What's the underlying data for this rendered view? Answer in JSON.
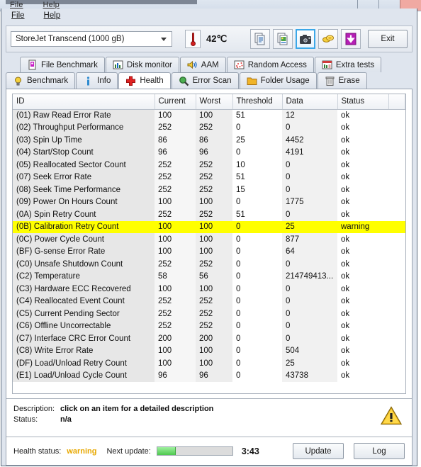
{
  "background_window": {
    "menu": [
      "File",
      "Help"
    ]
  },
  "window": {
    "menu": [
      "File",
      "Help"
    ]
  },
  "toolbar": {
    "drive": "StoreJet Transcend (1000 gB)",
    "temperature": "42℃",
    "exit_label": "Exit",
    "icons": [
      {
        "name": "copy-text-icon",
        "title": "copy text"
      },
      {
        "name": "copy-image-icon",
        "title": "copy image"
      },
      {
        "name": "screenshot-camera-icon",
        "title": "screenshot",
        "active": true
      },
      {
        "name": "coins-icon",
        "title": "donate"
      },
      {
        "name": "download-arrow-icon",
        "title": "save"
      }
    ]
  },
  "tabs": {
    "row1": [
      {
        "label": "File Benchmark",
        "icon": "file-benchmark-icon"
      },
      {
        "label": "Disk monitor",
        "icon": "disk-monitor-icon"
      },
      {
        "label": "AAM",
        "icon": "aam-speaker-icon"
      },
      {
        "label": "Random Access",
        "icon": "random-access-icon"
      },
      {
        "label": "Extra tests",
        "icon": "extra-tests-icon"
      }
    ],
    "row2": [
      {
        "label": "Benchmark",
        "icon": "benchmark-bulb-icon"
      },
      {
        "label": "Info",
        "icon": "info-icon"
      },
      {
        "label": "Health",
        "icon": "health-cross-icon",
        "active": true
      },
      {
        "label": "Error Scan",
        "icon": "error-scan-magnifier-icon"
      },
      {
        "label": "Folder Usage",
        "icon": "folder-usage-icon"
      },
      {
        "label": "Erase",
        "icon": "erase-trash-icon"
      }
    ]
  },
  "table": {
    "columns": [
      "ID",
      "Current",
      "Worst",
      "Threshold",
      "Data",
      "Status"
    ],
    "rows": [
      {
        "id": "(01) Raw Read Error Rate",
        "current": "100",
        "worst": "100",
        "threshold": "51",
        "data": "12",
        "status": "ok"
      },
      {
        "id": "(02) Throughput Performance",
        "current": "252",
        "worst": "252",
        "threshold": "0",
        "data": "0",
        "status": "ok"
      },
      {
        "id": "(03) Spin Up Time",
        "current": "86",
        "worst": "86",
        "threshold": "25",
        "data": "4452",
        "status": "ok"
      },
      {
        "id": "(04) Start/Stop Count",
        "current": "96",
        "worst": "96",
        "threshold": "0",
        "data": "4191",
        "status": "ok"
      },
      {
        "id": "(05) Reallocated Sector Count",
        "current": "252",
        "worst": "252",
        "threshold": "10",
        "data": "0",
        "status": "ok"
      },
      {
        "id": "(07) Seek Error Rate",
        "current": "252",
        "worst": "252",
        "threshold": "51",
        "data": "0",
        "status": "ok"
      },
      {
        "id": "(08) Seek Time Performance",
        "current": "252",
        "worst": "252",
        "threshold": "15",
        "data": "0",
        "status": "ok"
      },
      {
        "id": "(09) Power On Hours Count",
        "current": "100",
        "worst": "100",
        "threshold": "0",
        "data": "1775",
        "status": "ok"
      },
      {
        "id": "(0A) Spin Retry Count",
        "current": "252",
        "worst": "252",
        "threshold": "51",
        "data": "0",
        "status": "ok"
      },
      {
        "id": "(0B) Calibration Retry Count",
        "current": "100",
        "worst": "100",
        "threshold": "0",
        "data": "25",
        "status": "warning",
        "warn": true
      },
      {
        "id": "(0C) Power Cycle Count",
        "current": "100",
        "worst": "100",
        "threshold": "0",
        "data": "877",
        "status": "ok"
      },
      {
        "id": "(BF) G-sense Error Rate",
        "current": "100",
        "worst": "100",
        "threshold": "0",
        "data": "64",
        "status": "ok"
      },
      {
        "id": "(C0) Unsafe Shutdown Count",
        "current": "252",
        "worst": "252",
        "threshold": "0",
        "data": "0",
        "status": "ok"
      },
      {
        "id": "(C2) Temperature",
        "current": "58",
        "worst": "56",
        "threshold": "0",
        "data": "214749413...",
        "status": "ok"
      },
      {
        "id": "(C3) Hardware ECC Recovered",
        "current": "100",
        "worst": "100",
        "threshold": "0",
        "data": "0",
        "status": "ok"
      },
      {
        "id": "(C4) Reallocated Event Count",
        "current": "252",
        "worst": "252",
        "threshold": "0",
        "data": "0",
        "status": "ok"
      },
      {
        "id": "(C5) Current Pending Sector",
        "current": "252",
        "worst": "252",
        "threshold": "0",
        "data": "0",
        "status": "ok"
      },
      {
        "id": "(C6) Offline Uncorrectable",
        "current": "252",
        "worst": "252",
        "threshold": "0",
        "data": "0",
        "status": "ok"
      },
      {
        "id": "(C7) Interface CRC Error Count",
        "current": "200",
        "worst": "200",
        "threshold": "0",
        "data": "0",
        "status": "ok"
      },
      {
        "id": "(C8) Write Error Rate",
        "current": "100",
        "worst": "100",
        "threshold": "0",
        "data": "504",
        "status": "ok"
      },
      {
        "id": "(DF) Load/Unload Retry Count",
        "current": "100",
        "worst": "100",
        "threshold": "0",
        "data": "25",
        "status": "ok"
      },
      {
        "id": "(E1) Load/Unload Cycle Count",
        "current": "96",
        "worst": "96",
        "threshold": "0",
        "data": "43738",
        "status": "ok"
      }
    ]
  },
  "description": {
    "desc_label": "Description:",
    "desc_value": "click on an item for a detailed description",
    "status_label": "Status:",
    "status_value": "n/a"
  },
  "footer": {
    "health_label": "Health status:",
    "health_value": "warning",
    "next_label": "Next update:",
    "next_time": "3:43",
    "progress_percent": 25,
    "update_label": "Update",
    "log_label": "Log"
  },
  "colors": {
    "warning_row": "#ffff00",
    "warning_text": "#e8a800",
    "progress_fill": "#4ec94e",
    "accent_active_tab": "#ffffff"
  }
}
